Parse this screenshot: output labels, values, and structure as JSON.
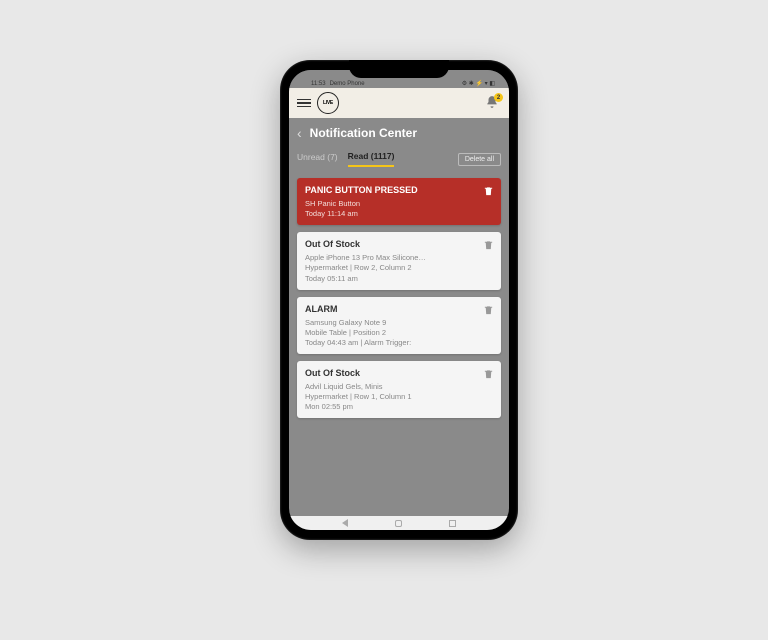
{
  "statusbar": {
    "time": "11:53",
    "device": "Demo Phone",
    "icons": "⚙ ✱ ⚡ ▾ ◧"
  },
  "appbar": {
    "logo_text": "LIVE",
    "notif_badge": "2"
  },
  "page": {
    "title": "Notification Center"
  },
  "tabs": {
    "unread": "Unread (7)",
    "read": "Read (1117)",
    "delete_all": "Delete all"
  },
  "cards": [
    {
      "title": "PANIC BUTTON PRESSED",
      "line1": "SH Panic Button",
      "line2": "Today 11:14 am",
      "variant": "red"
    },
    {
      "title": "Out Of Stock",
      "line1": "Apple iPhone 13 Pro Max Silicone…",
      "line2": "Hypermarket  |  Row 2, Column 2",
      "line3": "Today 05:11 am",
      "variant": "white"
    },
    {
      "title": "ALARM",
      "line1": "Samsung Galaxy Note 9",
      "line2": "Mobile Table  |  Position 2",
      "line3": "Today 04:43 am | Alarm Trigger:",
      "variant": "white"
    },
    {
      "title": "Out Of Stock",
      "line1": "Advil Liquid Gels, Minis",
      "line2": "Hypermarket  |  Row 1, Column 1",
      "line3": "Mon 02:55 pm",
      "variant": "white"
    }
  ]
}
